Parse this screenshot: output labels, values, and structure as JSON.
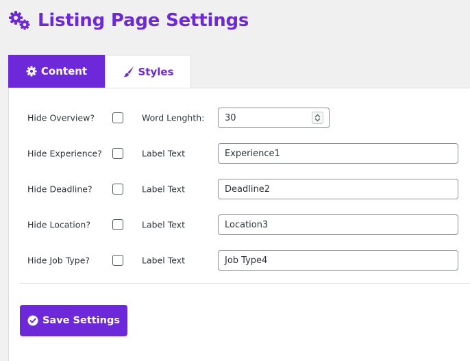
{
  "header": {
    "title": "Listing Page Settings",
    "icon": "gears-icon",
    "accent_color": "#6d28d9"
  },
  "tabs": [
    {
      "label": "Content",
      "icon": "gear-icon",
      "active": true
    },
    {
      "label": "Styles",
      "icon": "paintbrush-icon",
      "active": false
    }
  ],
  "settings": {
    "rows": [
      {
        "hide_label": "Hide Overview?",
        "checked": false,
        "field_label": "Word Lenghth:",
        "value": "30",
        "type": "number"
      },
      {
        "hide_label": "Hide Experience?",
        "checked": false,
        "field_label": "Label Text",
        "value": "Experience1",
        "type": "text"
      },
      {
        "hide_label": "Hide Deadline?",
        "checked": false,
        "field_label": "Label Text",
        "value": "Deadline2",
        "type": "text"
      },
      {
        "hide_label": "Hide Location?",
        "checked": false,
        "field_label": "Label Text",
        "value": "Location3",
        "type": "text"
      },
      {
        "hide_label": "Hide Job Type?",
        "checked": false,
        "field_label": "Label Text",
        "value": "Job Type4",
        "type": "text"
      }
    ]
  },
  "actions": {
    "save_label": "Save Settings",
    "save_icon": "check-circle-icon"
  }
}
